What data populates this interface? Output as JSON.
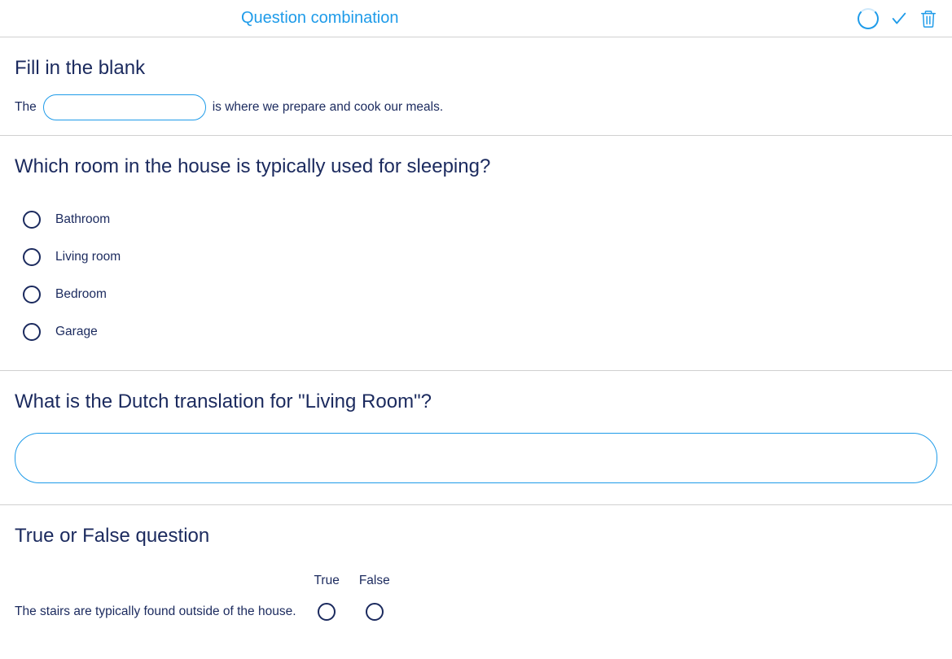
{
  "header": {
    "title": "Question combination"
  },
  "q1": {
    "title": "Fill in the blank",
    "before": "The",
    "after": "is where we prepare and cook our meals.",
    "value": ""
  },
  "q2": {
    "title": "Which room in the house is typically used for sleeping?",
    "options": [
      "Bathroom",
      "Living room",
      "Bedroom",
      "Garage"
    ]
  },
  "q3": {
    "title": "What is the Dutch translation for \"Living Room\"?",
    "value": ""
  },
  "q4": {
    "title": "True or False question",
    "col_true": "True",
    "col_false": "False",
    "statements": [
      "The stairs are typically found outside of the house."
    ]
  }
}
